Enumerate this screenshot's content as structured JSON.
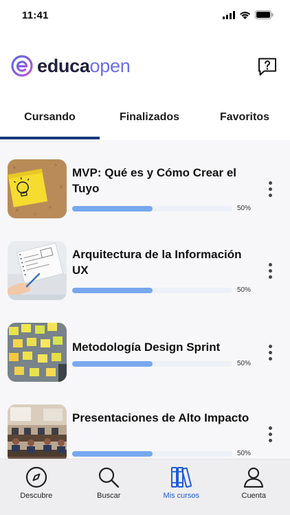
{
  "status_bar": {
    "time": "11:41",
    "icons": [
      "signal-icon",
      "wifi-icon",
      "battery-icon"
    ]
  },
  "header": {
    "logo_word_1": "educa",
    "logo_word_2": "open",
    "help_icon": "question-bubble-icon"
  },
  "tabs": [
    {
      "label": "Cursando",
      "active": true
    },
    {
      "label": "Finalizados",
      "active": false
    },
    {
      "label": "Favoritos",
      "active": false
    }
  ],
  "courses": [
    {
      "title": "MVP: Qué es y Cómo Crear el Tuyo",
      "progress": 0.5,
      "progress_label": "50%",
      "thumbnail": "sticky-note-lightbulb"
    },
    {
      "title": "Arquitectura de la Información UX",
      "progress": 0.5,
      "progress_label": "50%",
      "thumbnail": "notebook-sketching"
    },
    {
      "title": "Metodología Design Sprint",
      "progress": 0.5,
      "progress_label": "50%",
      "thumbnail": "sticky-notes-wall"
    },
    {
      "title": "Presentaciones de Alto Impacto",
      "progress": 0.5,
      "progress_label": "50%",
      "thumbnail": "classroom"
    }
  ],
  "bottom_nav": [
    {
      "label": "Descubre",
      "icon": "compass-icon",
      "active": false
    },
    {
      "label": "Buscar",
      "icon": "search-icon",
      "active": false
    },
    {
      "label": "Mis cursos",
      "icon": "books-icon",
      "active": true
    },
    {
      "label": "Cuenta",
      "icon": "user-icon",
      "active": false
    }
  ],
  "colors": {
    "accent": "#1f5bd6",
    "tab_indicator": "#17397a",
    "progress": "#78a8ee",
    "logo_purple": "#6a6ee8"
  }
}
